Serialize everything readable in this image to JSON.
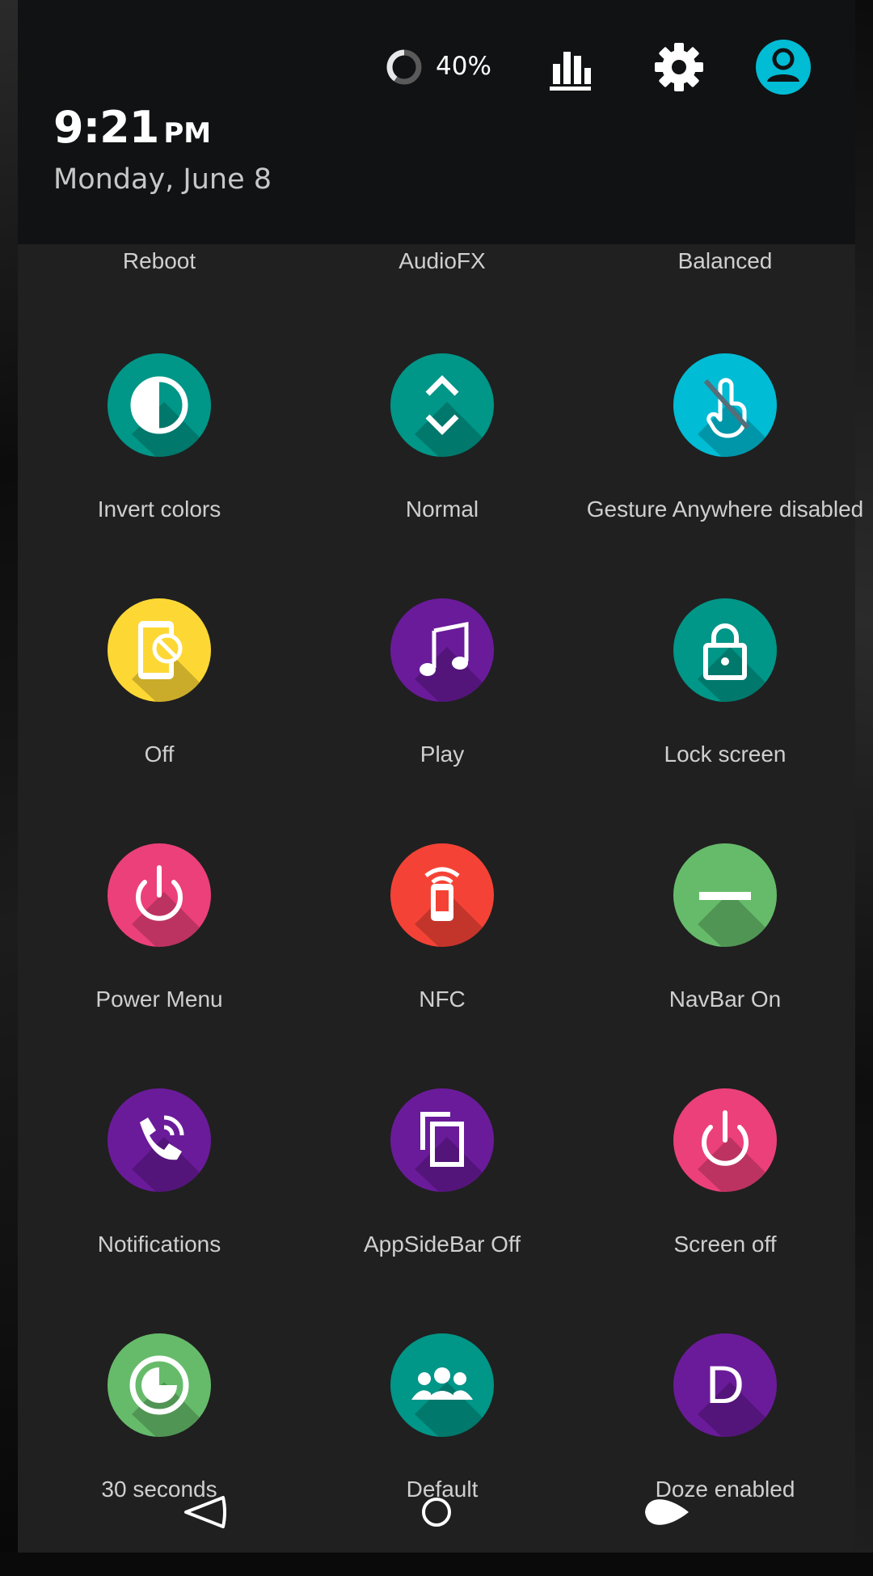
{
  "header": {
    "battery": {
      "percent_text": "40%",
      "level": 0.4
    },
    "clock": {
      "time": "9:21",
      "ampm": "PM"
    },
    "date": "Monday, June 8",
    "icons": [
      "battery-ring-icon",
      "bar-chart-icon",
      "gear-icon",
      "user-avatar-icon"
    ]
  },
  "top_row": [
    {
      "label": "Reboot"
    },
    {
      "label": "AudioFX"
    },
    {
      "label": "Balanced"
    }
  ],
  "tiles": [
    {
      "label": "Invert colors",
      "color": "#009688",
      "icon": "invert-colors-icon"
    },
    {
      "label": "Normal",
      "color": "#009688",
      "icon": "expand-collapse-icon"
    },
    {
      "label": "Gesture Anywhere disabled",
      "color": "#00bcd4",
      "icon": "gesture-disabled-icon"
    },
    {
      "label": "Off",
      "color": "#fdd835",
      "icon": "screen-rotation-off-icon"
    },
    {
      "label": "Play",
      "color": "#6a1b9a",
      "icon": "music-note-icon"
    },
    {
      "label": "Lock screen",
      "color": "#009688",
      "icon": "lock-icon"
    },
    {
      "label": "Power Menu",
      "color": "#ec407a",
      "icon": "power-icon"
    },
    {
      "label": "NFC",
      "color": "#f44336",
      "icon": "nfc-icon"
    },
    {
      "label": "NavBar On",
      "color": "#66bb6a",
      "icon": "navbar-icon"
    },
    {
      "label": "Notifications",
      "color": "#6a1b9a",
      "icon": "phone-ringing-icon"
    },
    {
      "label": "AppSideBar Off",
      "color": "#6a1b9a",
      "icon": "copy-pages-icon"
    },
    {
      "label": "Screen off",
      "color": "#ec407a",
      "icon": "power-icon"
    },
    {
      "label": "30 seconds",
      "color": "#66bb6a",
      "icon": "timeout-clock-icon"
    },
    {
      "label": "Default",
      "color": "#009688",
      "icon": "people-icon"
    },
    {
      "label": "Doze enabled",
      "color": "#6a1b9a",
      "icon": "doze-letter-icon",
      "glyph": "D"
    }
  ],
  "navbar": {
    "icons": [
      "back-icon",
      "home-icon",
      "recents-icon"
    ]
  }
}
